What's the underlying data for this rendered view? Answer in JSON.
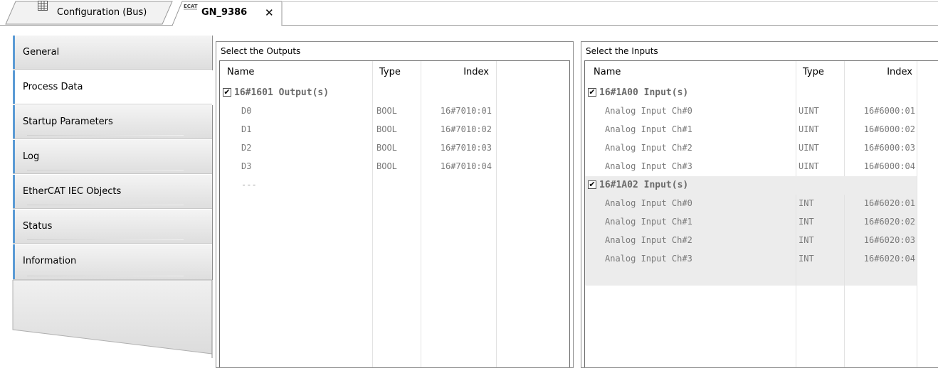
{
  "tabs": [
    {
      "label": "Configuration (Bus)",
      "icon": "grid-document-icon"
    },
    {
      "label": "GN_9386",
      "icon": "ethercat-icon",
      "close": "✕"
    }
  ],
  "nav": [
    {
      "label": "General"
    },
    {
      "label": "Process Data"
    },
    {
      "label": "Startup Parameters"
    },
    {
      "label": "Log"
    },
    {
      "label": "EtherCAT IEC Objects"
    },
    {
      "label": "Status"
    },
    {
      "label": "Information"
    }
  ],
  "outputs": {
    "title": "Select the Outputs",
    "columns": [
      "Name",
      "Type",
      "Index"
    ],
    "group": {
      "label": "16#1601 Output(s)",
      "checked": true,
      "checkmark": "✔"
    },
    "rows": [
      {
        "name": "D0",
        "type": "BOOL",
        "index": "16#7010:01"
      },
      {
        "name": "D1",
        "type": "BOOL",
        "index": "16#7010:02"
      },
      {
        "name": "D2",
        "type": "BOOL",
        "index": "16#7010:03"
      },
      {
        "name": "D3",
        "type": "BOOL",
        "index": "16#7010:04"
      }
    ],
    "placeholder": "---"
  },
  "inputs": {
    "title": "Select the Inputs",
    "columns": [
      "Name",
      "Type",
      "Index"
    ],
    "groups": [
      {
        "label": "16#1A00 Input(s)",
        "checked": true,
        "checkmark": "✔",
        "rows": [
          {
            "name": "Analog Input Ch#0",
            "type": "UINT",
            "index": "16#6000:01"
          },
          {
            "name": "Analog Input Ch#1",
            "type": "UINT",
            "index": "16#6000:02"
          },
          {
            "name": "Analog Input Ch#2",
            "type": "UINT",
            "index": "16#6000:03"
          },
          {
            "name": "Analog Input Ch#3",
            "type": "UINT",
            "index": "16#6000:04"
          }
        ]
      },
      {
        "label": "16#1A02 Input(s)",
        "checked": true,
        "checkmark": "✔",
        "rows": [
          {
            "name": "Analog Input Ch#0",
            "type": "INT",
            "index": "16#6020:01"
          },
          {
            "name": "Analog Input Ch#1",
            "type": "INT",
            "index": "16#6020:02"
          },
          {
            "name": "Analog Input Ch#2",
            "type": "INT",
            "index": "16#6020:03"
          },
          {
            "name": "Analog Input Ch#3",
            "type": "INT",
            "index": "16#6020:04"
          }
        ]
      }
    ]
  },
  "colors": {
    "nav_accent": "#5b9bd5",
    "grid_text": "#7a7a7a",
    "group_text": "#6a6a6a",
    "shaded_row": "#ececec"
  }
}
